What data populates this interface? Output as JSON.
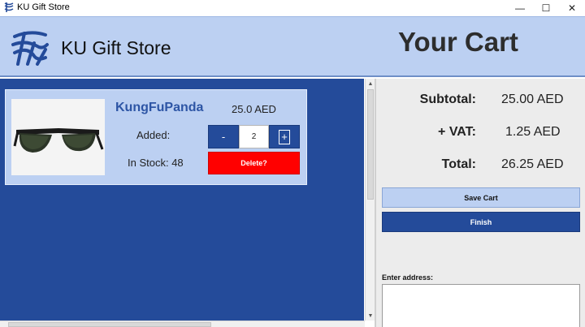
{
  "window": {
    "title": "KU Gift Store",
    "controls": {
      "minimize": "—",
      "maximize": "☐",
      "close": "✕"
    }
  },
  "header": {
    "store_name": "KU Gift Store",
    "cart_title": "Your Cart"
  },
  "cart_items": [
    {
      "name": "KungFuPanda",
      "price": "25.0 AED",
      "added_label": "Added:",
      "quantity": "2",
      "minus_label": "-",
      "plus_label": "+",
      "stock_label": "In Stock: 48",
      "delete_label": "Delete?",
      "image": "sunglasses"
    }
  ],
  "summary": {
    "subtotal_label": "Subtotal:",
    "subtotal_value": "25.00 AED",
    "vat_label": "+ VAT:",
    "vat_value": "1.25 AED",
    "total_label": "Total:",
    "total_value": "26.25 AED"
  },
  "actions": {
    "save_label": "Save Cart",
    "finish_label": "Finish"
  },
  "address": {
    "label": "Enter address:",
    "value": ""
  },
  "colors": {
    "accent_dark": "#244b9a",
    "accent_light": "#bcd0f2",
    "delete": "#ff0000"
  }
}
